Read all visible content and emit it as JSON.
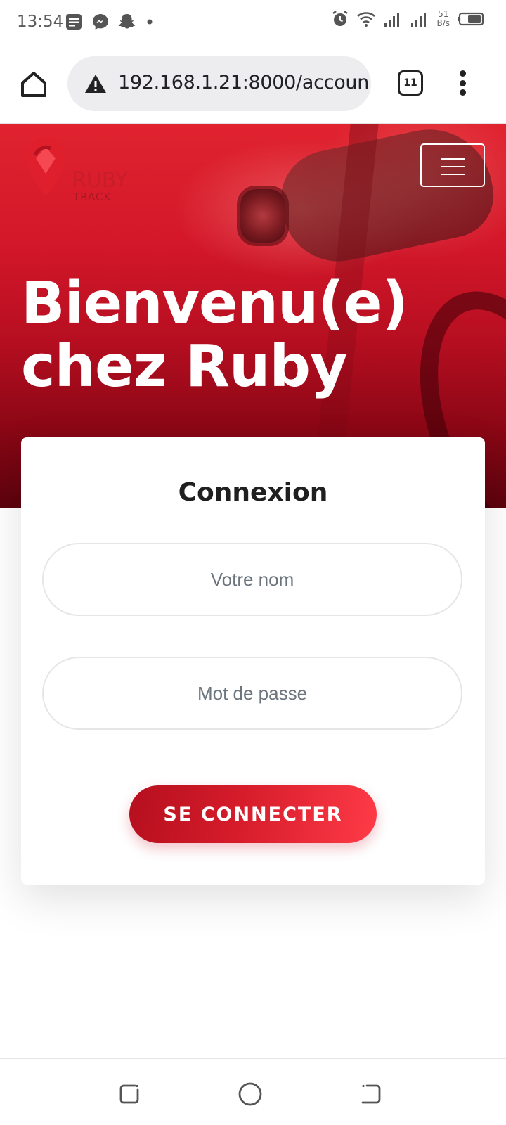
{
  "status_bar": {
    "time": "13:54",
    "net_speed_value": "51",
    "net_speed_unit": "B/s",
    "left_icons": [
      "notes-icon",
      "messenger-icon",
      "snapchat-icon",
      "dot-icon"
    ],
    "right_icons": [
      "alarm-icon",
      "wifi-icon",
      "signal-icon",
      "signal-icon",
      "battery-icon"
    ]
  },
  "browser": {
    "url": "192.168.1.21:8000/accoun",
    "tab_count": "11"
  },
  "site": {
    "logo_text": "RUBY",
    "logo_sub": "TRACK",
    "hero_title_line1": "Bienvenu(e)",
    "hero_title_line2": "chez Ruby",
    "brand_color": "#d61c2b"
  },
  "login": {
    "title": "Connexion",
    "name_placeholder": "Votre nom",
    "password_placeholder": "Mot de passe",
    "submit_label": "SE CONNECTER"
  }
}
